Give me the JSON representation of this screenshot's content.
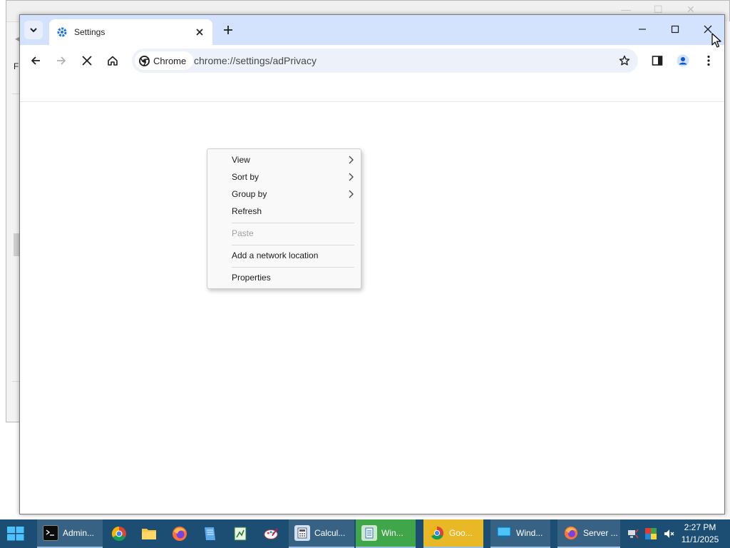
{
  "background_window": {
    "menu_letters": "Fi"
  },
  "browser": {
    "tab": {
      "title": "Settings"
    },
    "omnibox": {
      "chip_label": "Chrome",
      "url": "chrome://settings/adPrivacy"
    }
  },
  "context_menu": {
    "items": [
      {
        "label": "View",
        "submenu": true,
        "disabled": false
      },
      {
        "label": "Sort by",
        "submenu": true,
        "disabled": false
      },
      {
        "label": "Group by",
        "submenu": true,
        "disabled": false
      },
      {
        "label": "Refresh",
        "submenu": false,
        "disabled": false
      },
      {
        "label": "Paste",
        "submenu": false,
        "disabled": true
      },
      {
        "label": "Add a network location",
        "submenu": false,
        "disabled": false
      },
      {
        "label": "Properties",
        "submenu": false,
        "disabled": false
      }
    ]
  },
  "taskbar": {
    "items": [
      {
        "label": "Admin...",
        "icon": "terminal-icon"
      },
      {
        "label": "Calcul...",
        "icon": "calculator-icon"
      },
      {
        "label": "Win...",
        "icon": "notepad-icon"
      },
      {
        "label": "Goo...",
        "icon": "chrome-icon"
      },
      {
        "label": "Wind...",
        "icon": "monitor-icon"
      },
      {
        "label": "Server ...",
        "icon": "firefox-icon"
      }
    ],
    "pinned": [
      "chrome-icon",
      "folder-icon",
      "firefox-icon",
      "notebook-icon",
      "spreadsheet-icon",
      "paint-icon"
    ],
    "clock": {
      "time": "2:27 PM",
      "date": "11/1/2025"
    }
  },
  "colors": {
    "tabstrip": "#d3e3fd",
    "taskbar": "#1c4d73",
    "accent_green": "#3fa64a",
    "accent_yellow": "#e8b826"
  }
}
